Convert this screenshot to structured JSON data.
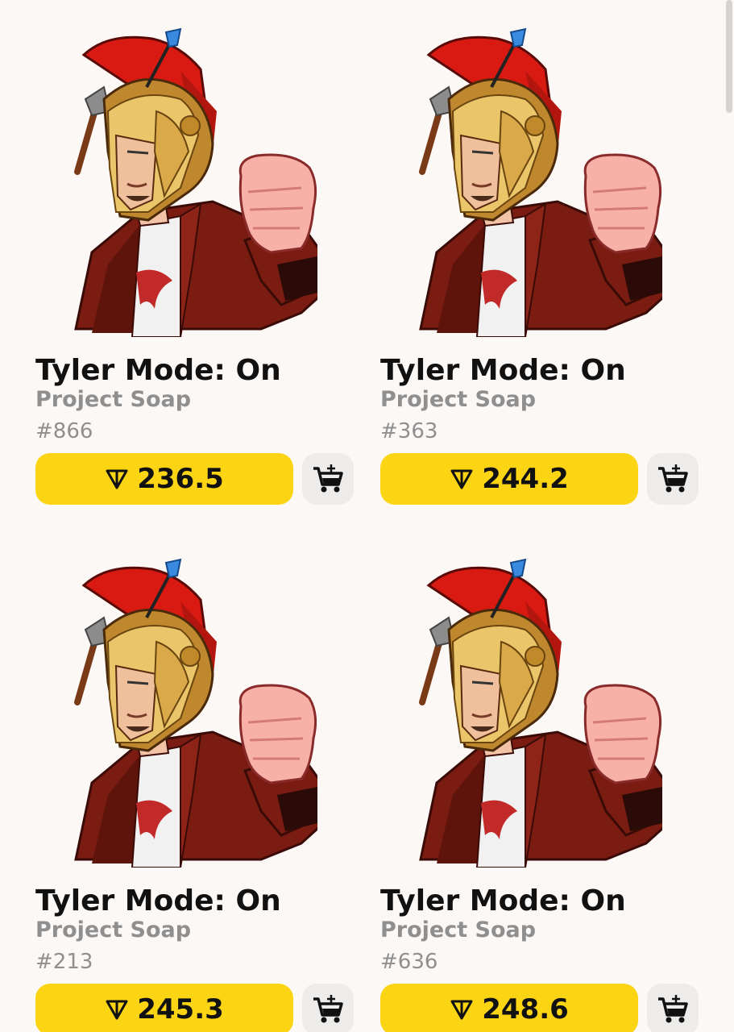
{
  "items": [
    {
      "title": "Tyler Mode: On",
      "collection": "Project Soap",
      "number": "#866",
      "price": "236.5"
    },
    {
      "title": "Tyler Mode: On",
      "collection": "Project Soap",
      "number": "#363",
      "price": "244.2"
    },
    {
      "title": "Tyler Mode: On",
      "collection": "Project Soap",
      "number": "#213",
      "price": "245.3"
    },
    {
      "title": "Tyler Mode: On",
      "collection": "Project Soap",
      "number": "#636",
      "price": "248.6"
    }
  ],
  "icons": {
    "price_icon": "ton-diamond-icon",
    "cart_icon": "add-to-cart-icon",
    "artwork": "spartan-helmet-character"
  },
  "colors": {
    "price_button": "#fbd414",
    "cart_button": "#edeceb",
    "background": "#fcf8f6"
  }
}
